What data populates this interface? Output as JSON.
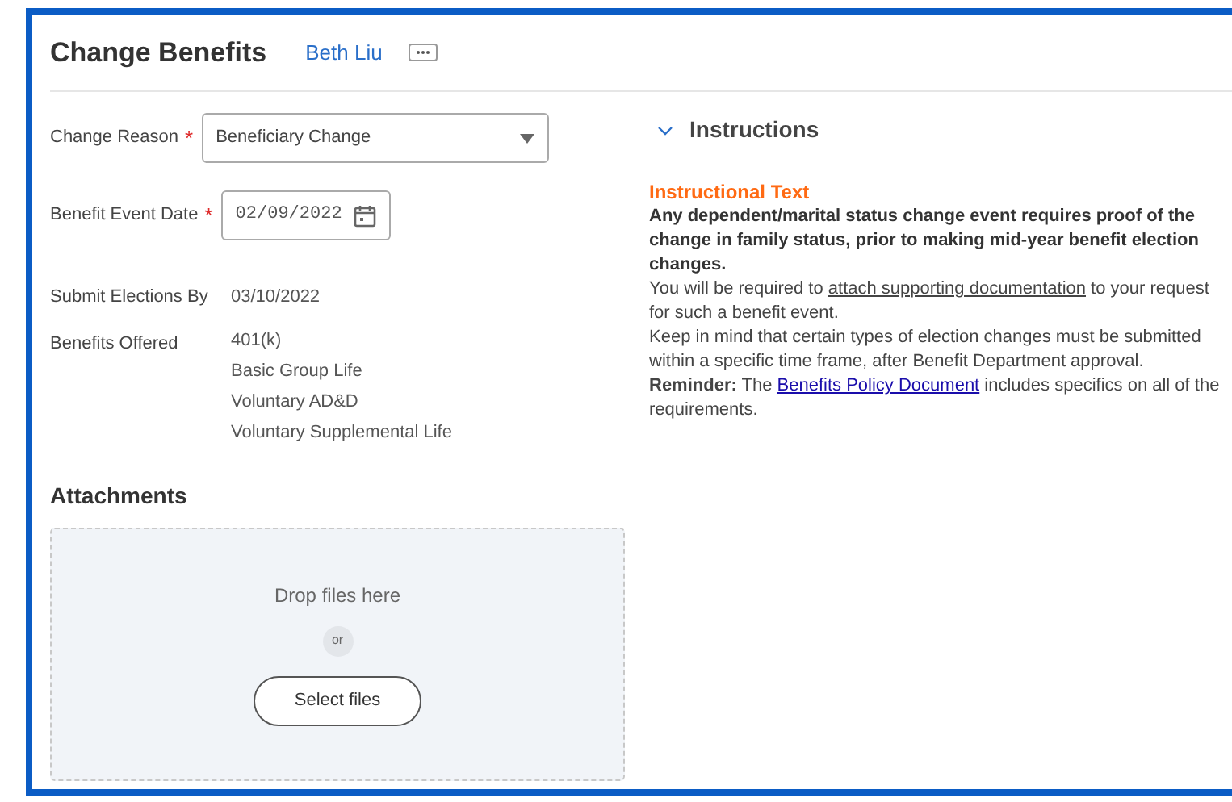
{
  "header": {
    "title": "Change Benefits",
    "worker": "Beth Liu"
  },
  "form": {
    "change_reason": {
      "label": "Change Reason",
      "required_mark": "*",
      "value": "Beneficiary Change"
    },
    "benefit_event_date": {
      "label": "Benefit Event Date",
      "required_mark": "*",
      "value": "02/09/2022"
    },
    "submit_elections_by": {
      "label": "Submit Elections By",
      "value": "03/10/2022"
    },
    "benefits_offered": {
      "label": "Benefits Offered",
      "values": [
        "401(k)",
        "Basic Group Life",
        "Voluntary AD&D",
        "Voluntary Supplemental Life"
      ]
    }
  },
  "attachments": {
    "title": "Attachments",
    "drop_text": "Drop files here",
    "or": "or",
    "button": "Select files"
  },
  "instructions": {
    "title": "Instructions",
    "expanded": true,
    "heading": "Instructional Text",
    "paragraphs": [
      {
        "kind": "bold",
        "segments": [
          {
            "kind": "text",
            "text": "Any dependent/marital status change event requires proof of the change in family status, prior to making mid-year benefit election changes."
          }
        ]
      },
      {
        "kind": "plain",
        "segments": [
          {
            "kind": "text",
            "text": "You will be required to "
          },
          {
            "kind": "underline",
            "text": "attach supporting documentation"
          },
          {
            "kind": "text",
            "text": " to your request for such a benefit event."
          }
        ]
      },
      {
        "kind": "plain",
        "segments": [
          {
            "kind": "text",
            "text": "Keep in mind that certain types of election changes must be submitted within a specific time frame, after Benefit Department approval."
          }
        ]
      },
      {
        "kind": "plain",
        "segments": [
          {
            "kind": "text",
            "text": "**Reminder:** The "
          },
          {
            "kind": "link",
            "text": "Benefits Policy Document"
          },
          {
            "kind": "text",
            "text": " includes specifics on all of the requirements."
          }
        ]
      }
    ]
  }
}
